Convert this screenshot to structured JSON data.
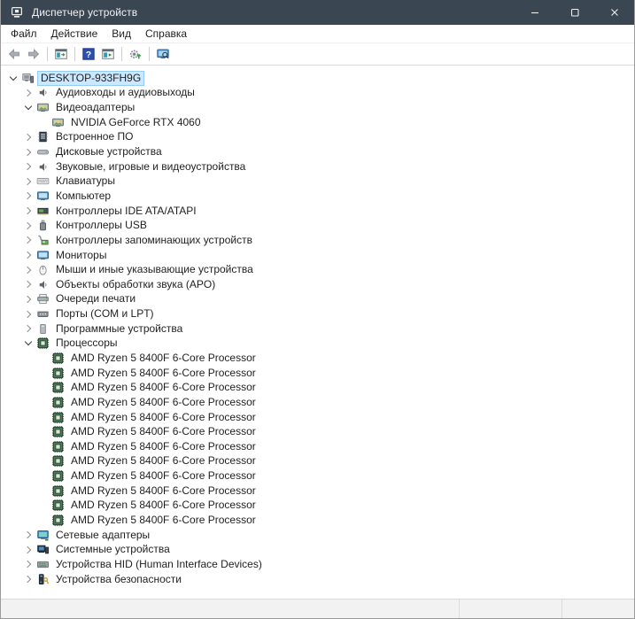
{
  "window": {
    "title": "Диспетчер устройств"
  },
  "colors": {
    "titlebar": "#3b4653",
    "selection_bg": "#cce8ff",
    "selection_border": "#93cdf2",
    "help_button_blue": "#2a4fae",
    "cpu_icon_green": "#50785a"
  },
  "menu": {
    "items": [
      {
        "id": "file",
        "label": "Файл"
      },
      {
        "id": "action",
        "label": "Действие"
      },
      {
        "id": "view",
        "label": "Вид"
      },
      {
        "id": "help",
        "label": "Справка"
      }
    ]
  },
  "toolbar": {
    "items": [
      {
        "id": "back",
        "icon": "back-icon"
      },
      {
        "id": "forward",
        "icon": "forward-icon"
      },
      {
        "type": "separator"
      },
      {
        "id": "show-console-tree",
        "icon": "console-tree-icon"
      },
      {
        "type": "separator"
      },
      {
        "id": "help",
        "icon": "help-icon"
      },
      {
        "id": "properties",
        "icon": "properties-window-icon"
      },
      {
        "type": "separator"
      },
      {
        "id": "update-driver",
        "icon": "update-driver-icon"
      },
      {
        "type": "separator"
      },
      {
        "id": "scan-hardware-changes",
        "icon": "scan-icon"
      }
    ]
  },
  "tree": {
    "items": [
      {
        "id": "desktop-root",
        "label": "DESKTOP-933FH9G",
        "icon": "computer-icon",
        "depth": 0,
        "expand": "expanded",
        "selected": true
      },
      {
        "id": "audio-inputs-outputs",
        "label": "Аудиовходы и аудиовыходы",
        "icon": "speaker-icon",
        "depth": 1,
        "expand": "collapsed"
      },
      {
        "id": "display-adapters",
        "label": "Видеоадаптеры",
        "icon": "display-adapter-icon",
        "depth": 1,
        "expand": "expanded"
      },
      {
        "id": "nvidia-geforce-rtx-4060",
        "label": "NVIDIA GeForce RTX 4060",
        "icon": "display-adapter-icon",
        "depth": 2,
        "expand": "none"
      },
      {
        "id": "firmware",
        "label": "Встроенное ПО",
        "icon": "firmware-icon",
        "depth": 1,
        "expand": "collapsed"
      },
      {
        "id": "disk-drives",
        "label": "Дисковые устройства",
        "icon": "disk-drive-icon",
        "depth": 1,
        "expand": "collapsed"
      },
      {
        "id": "sound-game-video-devices",
        "label": "Звуковые, игровые и видеоустройства",
        "icon": "speaker-icon",
        "depth": 1,
        "expand": "collapsed"
      },
      {
        "id": "keyboards",
        "label": "Клавиатуры",
        "icon": "keyboard-icon",
        "depth": 1,
        "expand": "collapsed"
      },
      {
        "id": "computer",
        "label": "Компьютер",
        "icon": "monitor-icon",
        "depth": 1,
        "expand": "collapsed"
      },
      {
        "id": "ide-ata-atapi-controllers",
        "label": "Контроллеры IDE ATA/ATAPI",
        "icon": "ide-controller-icon",
        "depth": 1,
        "expand": "collapsed"
      },
      {
        "id": "usb-controllers",
        "label": "Контроллеры USB",
        "icon": "usb-icon",
        "depth": 1,
        "expand": "collapsed"
      },
      {
        "id": "storage-controllers",
        "label": "Контроллеры запоминающих устройств",
        "icon": "storage-controller-icon",
        "depth": 1,
        "expand": "collapsed"
      },
      {
        "id": "monitors",
        "label": "Мониторы",
        "icon": "monitor-icon",
        "depth": 1,
        "expand": "collapsed"
      },
      {
        "id": "mice-pointing-devices",
        "label": "Мыши и иные указывающие устройства",
        "icon": "mouse-icon",
        "depth": 1,
        "expand": "collapsed"
      },
      {
        "id": "audio-processing-objects",
        "label": "Объекты обработки звука (APO)",
        "icon": "speaker-icon",
        "depth": 1,
        "expand": "collapsed"
      },
      {
        "id": "print-queues",
        "label": "Очереди печати",
        "icon": "printer-icon",
        "depth": 1,
        "expand": "collapsed"
      },
      {
        "id": "ports-com-lpt",
        "label": "Порты (COM и LPT)",
        "icon": "port-icon",
        "depth": 1,
        "expand": "collapsed"
      },
      {
        "id": "software-devices",
        "label": "Программные устройства",
        "icon": "software-device-icon",
        "depth": 1,
        "expand": "collapsed"
      },
      {
        "id": "processors",
        "label": "Процессоры",
        "icon": "cpu-icon",
        "depth": 1,
        "expand": "expanded"
      },
      {
        "id": "processor-core-1",
        "label": "AMD Ryzen 5 8400F 6-Core Processor",
        "icon": "cpu-icon",
        "depth": 2,
        "expand": "none"
      },
      {
        "id": "processor-core-2",
        "label": "AMD Ryzen 5 8400F 6-Core Processor",
        "icon": "cpu-icon",
        "depth": 2,
        "expand": "none"
      },
      {
        "id": "processor-core-3",
        "label": "AMD Ryzen 5 8400F 6-Core Processor",
        "icon": "cpu-icon",
        "depth": 2,
        "expand": "none"
      },
      {
        "id": "processor-core-4",
        "label": "AMD Ryzen 5 8400F 6-Core Processor",
        "icon": "cpu-icon",
        "depth": 2,
        "expand": "none"
      },
      {
        "id": "processor-core-5",
        "label": "AMD Ryzen 5 8400F 6-Core Processor",
        "icon": "cpu-icon",
        "depth": 2,
        "expand": "none"
      },
      {
        "id": "processor-core-6",
        "label": "AMD Ryzen 5 8400F 6-Core Processor",
        "icon": "cpu-icon",
        "depth": 2,
        "expand": "none"
      },
      {
        "id": "processor-core-7",
        "label": "AMD Ryzen 5 8400F 6-Core Processor",
        "icon": "cpu-icon",
        "depth": 2,
        "expand": "none"
      },
      {
        "id": "processor-core-8",
        "label": "AMD Ryzen 5 8400F 6-Core Processor",
        "icon": "cpu-icon",
        "depth": 2,
        "expand": "none"
      },
      {
        "id": "processor-core-9",
        "label": "AMD Ryzen 5 8400F 6-Core Processor",
        "icon": "cpu-icon",
        "depth": 2,
        "expand": "none"
      },
      {
        "id": "processor-core-10",
        "label": "AMD Ryzen 5 8400F 6-Core Processor",
        "icon": "cpu-icon",
        "depth": 2,
        "expand": "none"
      },
      {
        "id": "processor-core-11",
        "label": "AMD Ryzen 5 8400F 6-Core Processor",
        "icon": "cpu-icon",
        "depth": 2,
        "expand": "none"
      },
      {
        "id": "processor-core-12",
        "label": "AMD Ryzen 5 8400F 6-Core Processor",
        "icon": "cpu-icon",
        "depth": 2,
        "expand": "none"
      },
      {
        "id": "network-adapters",
        "label": "Сетевые адаптеры",
        "icon": "network-adapter-icon",
        "depth": 1,
        "expand": "collapsed"
      },
      {
        "id": "system-devices",
        "label": "Системные устройства",
        "icon": "system-device-icon",
        "depth": 1,
        "expand": "collapsed"
      },
      {
        "id": "hid-devices",
        "label": "Устройства HID (Human Interface Devices)",
        "icon": "hid-icon",
        "depth": 1,
        "expand": "collapsed"
      },
      {
        "id": "security-devices",
        "label": "Устройства безопасности",
        "icon": "security-device-icon",
        "depth": 1,
        "expand": "collapsed"
      }
    ]
  }
}
